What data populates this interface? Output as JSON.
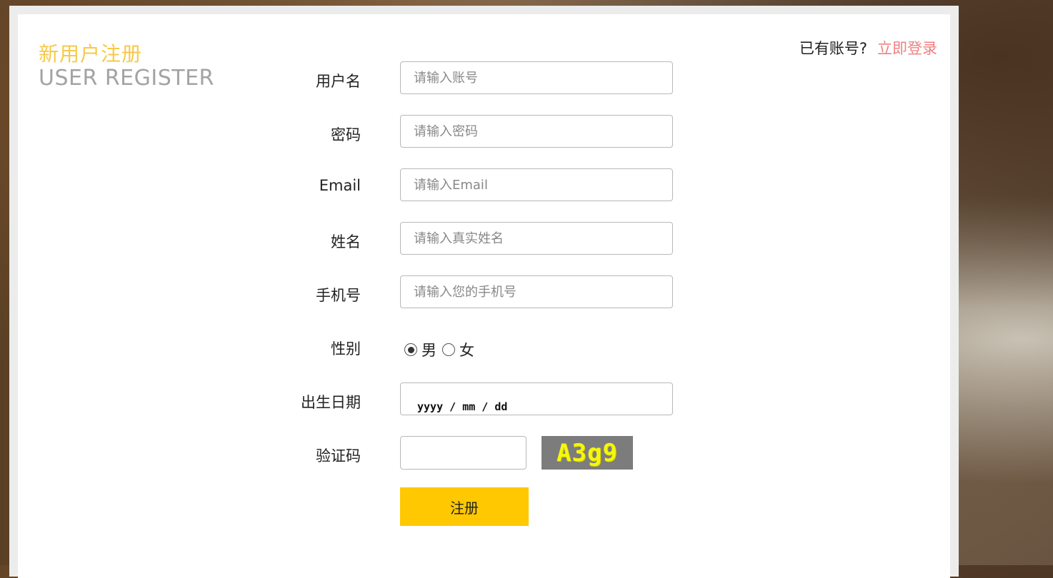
{
  "header": {
    "title_cn": "新用户注册",
    "title_en": "USER REGISTER",
    "login_prompt": "已有账号?",
    "login_link": "立即登录"
  },
  "form": {
    "username": {
      "label": "用户名",
      "placeholder": "请输入账号"
    },
    "password": {
      "label": "密码",
      "placeholder": "请输入密码"
    },
    "email": {
      "label": "Email",
      "placeholder": "请输入Email"
    },
    "name": {
      "label": "姓名",
      "placeholder": "请输入真实姓名"
    },
    "phone": {
      "label": "手机号",
      "placeholder": "请输入您的手机号"
    },
    "gender": {
      "label": "性别",
      "options": [
        "男",
        "女"
      ],
      "selected": "男"
    },
    "birthday": {
      "label": "出生日期",
      "placeholder": "yyyy / mm / dd"
    },
    "captcha": {
      "label": "验证码",
      "code": "A3g9"
    },
    "submit_label": "注册"
  },
  "colors": {
    "accent_yellow": "#ffc800",
    "title_yellow": "#f7c948",
    "link_pink": "#f08080"
  }
}
